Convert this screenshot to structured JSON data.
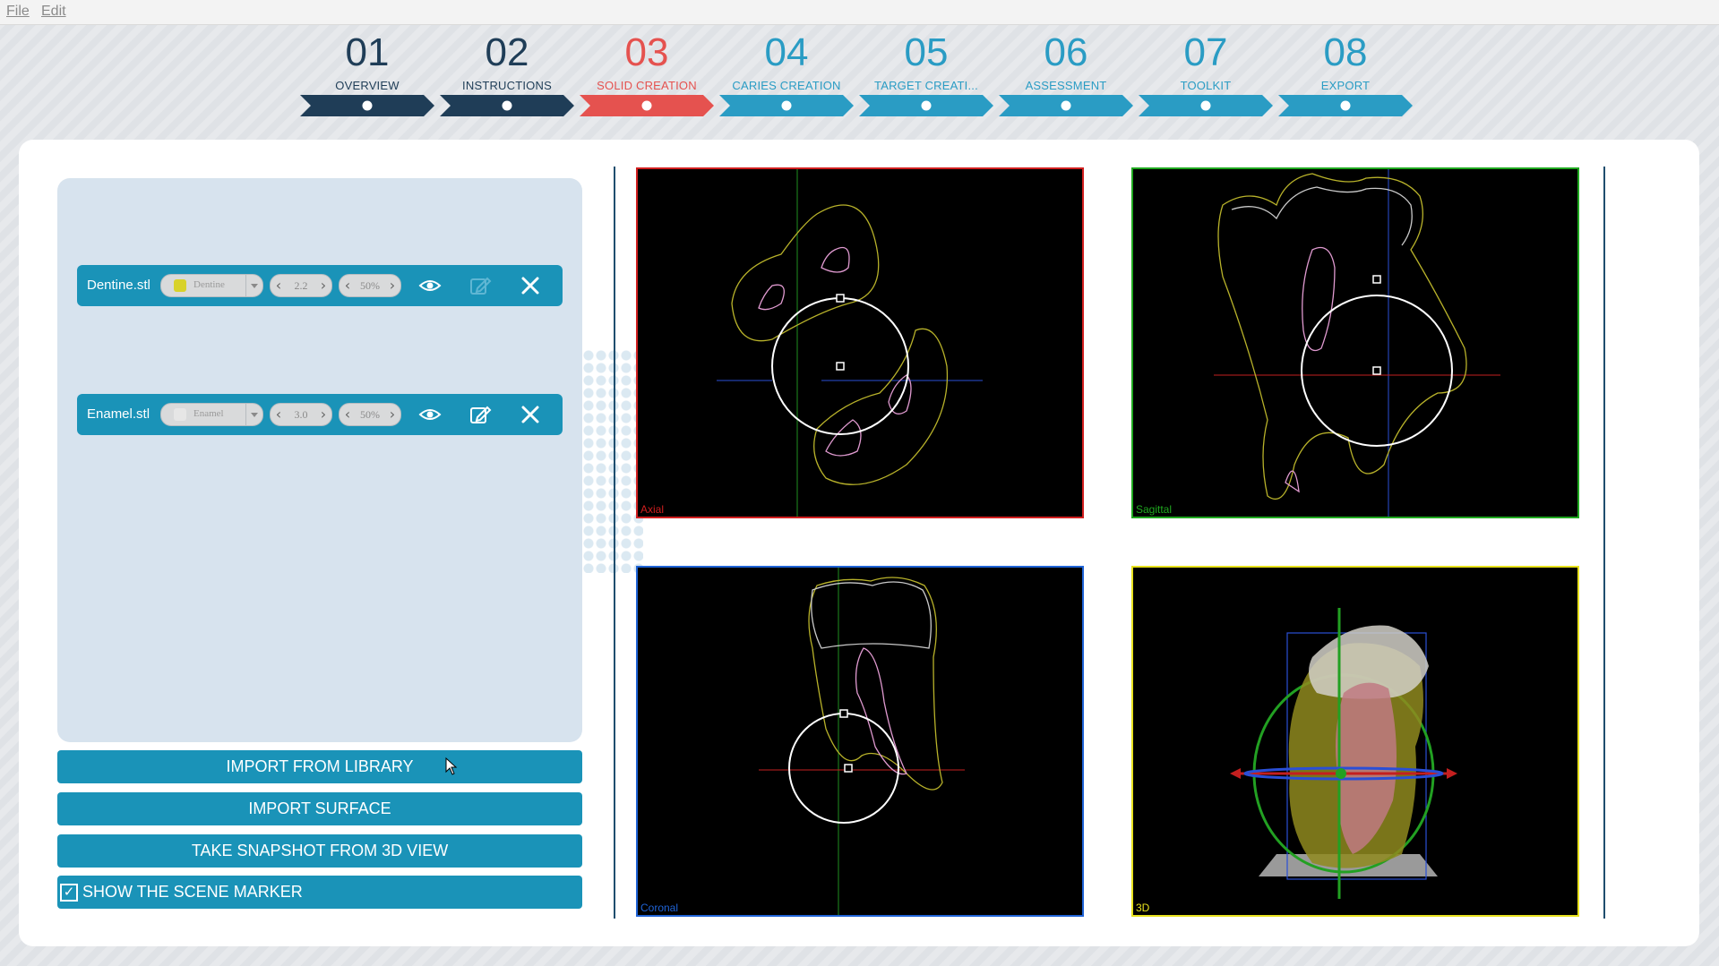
{
  "menu": {
    "file": "File",
    "edit": "Edit"
  },
  "steps": [
    {
      "num": "01",
      "label": "OVERVIEW",
      "state": "done"
    },
    {
      "num": "02",
      "label": "INSTRUCTIONS",
      "state": "done"
    },
    {
      "num": "03",
      "label": "SOLID CREATION",
      "state": "active"
    },
    {
      "num": "04",
      "label": "CARIES CREATION",
      "state": "future"
    },
    {
      "num": "05",
      "label": "TARGET CREATI...",
      "state": "future"
    },
    {
      "num": "06",
      "label": "ASSESSMENT",
      "state": "future"
    },
    {
      "num": "07",
      "label": "TOOLKIT",
      "state": "future"
    },
    {
      "num": "08",
      "label": "EXPORT",
      "state": "future"
    }
  ],
  "layers": [
    {
      "file": "Dentine.stl",
      "material": "Dentine",
      "swatch": "#d8d22a",
      "thickness": "2.2",
      "opacity": "50%"
    },
    {
      "file": "Enamel.stl",
      "material": "Enamel",
      "swatch": "#e6e6e6",
      "thickness": "3.0",
      "opacity": "50%"
    }
  ],
  "buttons": {
    "import_library": "IMPORT FROM LIBRARY",
    "import_surface": "IMPORT SURFACE",
    "snapshot": "TAKE SNAPSHOT FROM 3D VIEW",
    "scene_marker": "SHOW THE SCENE MARKER",
    "scene_marker_checked": "✓"
  },
  "views": {
    "axial": "Axial",
    "sagittal": "Sagittal",
    "coronal": "Coronal",
    "threed": "3D"
  },
  "colors": {
    "step_done": "#1f3d57",
    "step_active": "#e5524f",
    "step_future": "#2a9cc4",
    "accent": "#1a93b8",
    "axial_border": "#d11f1f",
    "sagittal_border": "#1fa81f",
    "coronal_border": "#1f63d6",
    "threed_border": "#e8e21d"
  }
}
